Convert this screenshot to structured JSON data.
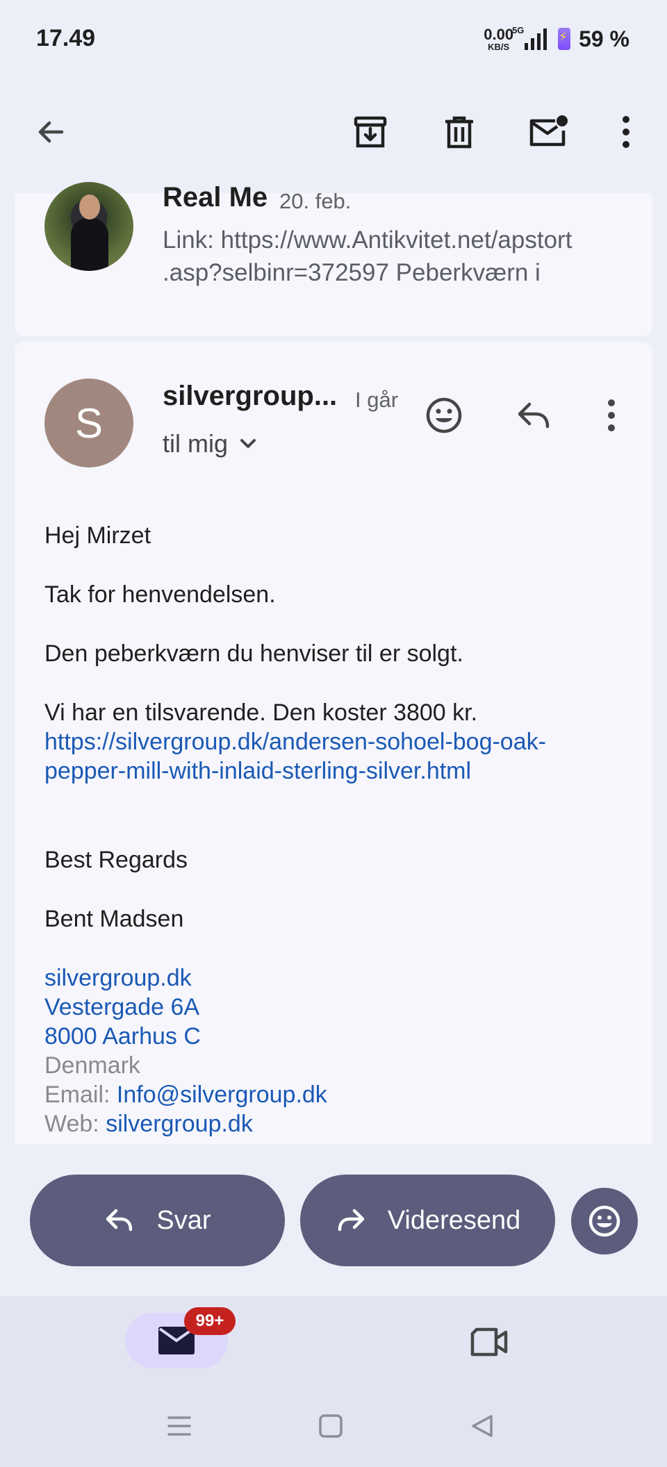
{
  "status_bar": {
    "time": "17.49",
    "net_speed_value": "0.00",
    "net_speed_unit": "KB/S",
    "network_type": "5G",
    "battery": "59 %"
  },
  "toolbar": {
    "back_icon": "arrow-left-icon",
    "archive_icon": "archive-icon",
    "delete_icon": "trash-icon",
    "unread_icon": "mark-unread-icon",
    "more_icon": "more-vert-icon"
  },
  "prev_message": {
    "sender": "Real Me",
    "date": "20. feb.",
    "preview": "Link: https://www.Antikvitet.net/apstort .asp?selbinr=372597 Peberkværn i"
  },
  "message": {
    "avatar_letter": "S",
    "sender": "silvergroup...",
    "date": "I går",
    "recipients": "til mig",
    "avatar_color": "#a1887f",
    "body": {
      "greeting": "Hej Mirzet",
      "line1": "Tak for henvendelsen.",
      "line2": "Den peberkværn du henviser til er solgt.",
      "line3": "Vi har en tilsvarende. Den koster 3800 kr.",
      "link_line1": "https://silvergroup.dk/andersen-sohoel-bog-oak-",
      "link_line2": "pepper-mill-with-inlaid-sterling-silver.html",
      "regards": "Best Regards",
      "name": "Bent Madsen",
      "sig_site": "silvergroup.dk",
      "sig_street": "Vestergade 6A",
      "sig_city": "8000 Aarhus C",
      "sig_country": "Denmark",
      "email_label": "Email: ",
      "email_value": "Info@silvergroup.dk",
      "web_label": "Web: ",
      "web_value": "silvergroup.dk"
    }
  },
  "actions": {
    "reply": "Svar",
    "forward": "Videresend"
  },
  "bottom_nav": {
    "mail_badge": "99+"
  },
  "colors": {
    "accent_pill": "#5c5c7c",
    "link": "#1a59b5",
    "badge": "#c5221f"
  }
}
